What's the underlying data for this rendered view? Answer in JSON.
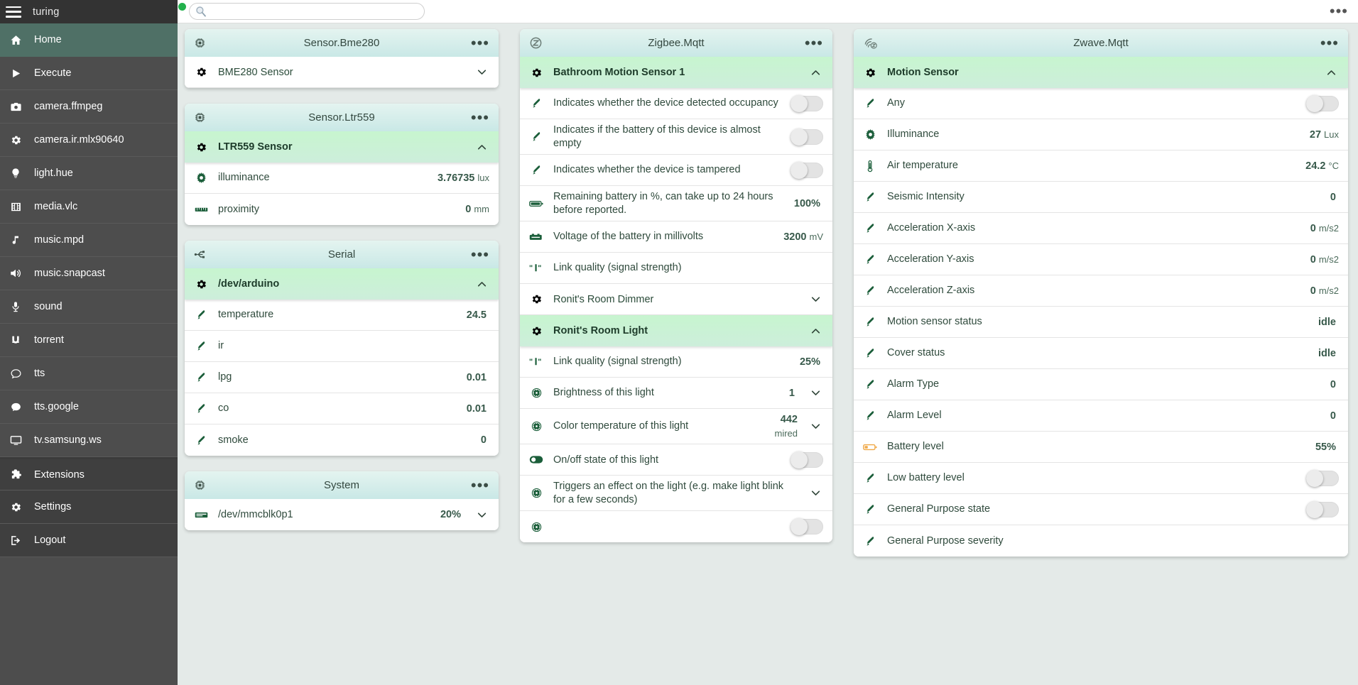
{
  "sidebar": {
    "brand": "turing",
    "items": [
      {
        "label": "Home",
        "icon": "home-icon",
        "active": true
      },
      {
        "label": "Execute",
        "icon": "play-icon"
      },
      {
        "label": "camera.ffmpeg",
        "icon": "camera-icon"
      },
      {
        "label": "camera.ir.mlx90640",
        "icon": "gear-icon"
      },
      {
        "label": "light.hue",
        "icon": "bulb-icon"
      },
      {
        "label": "media.vlc",
        "icon": "film-icon"
      },
      {
        "label": "music.mpd",
        "icon": "music-note-icon"
      },
      {
        "label": "music.snapcast",
        "icon": "speaker-icon"
      },
      {
        "label": "sound",
        "icon": "microphone-icon"
      },
      {
        "label": "torrent",
        "icon": "magnet-icon"
      },
      {
        "label": "tts",
        "icon": "chat-outline-icon"
      },
      {
        "label": "tts.google",
        "icon": "chat-filled-icon"
      },
      {
        "label": "tv.samsung.ws",
        "icon": "monitor-icon"
      }
    ],
    "footer_items": [
      {
        "label": "Extensions",
        "icon": "puzzle-icon"
      },
      {
        "label": "Settings",
        "icon": "gear-icon"
      },
      {
        "label": "Logout",
        "icon": "logout-icon"
      }
    ]
  },
  "topbar": {
    "search_placeholder": "",
    "search_value": "",
    "status_color": "#22b14c",
    "menu_label": "•••"
  },
  "columns": [
    {
      "cards": [
        {
          "title": "Sensor.Bme280",
          "icon": "chip-icon",
          "menu": "•••",
          "groups": [
            {
              "label": "BME280 Sensor",
              "icon": "gear-icon",
              "expanded": false,
              "chevron": "down",
              "rows": []
            }
          ]
        },
        {
          "title": "Sensor.Ltr559",
          "icon": "chip-icon",
          "menu": "•••",
          "groups": [
            {
              "label": "LTR559 Sensor",
              "icon": "gear-icon",
              "expanded": true,
              "chevron": "up",
              "rows": [
                {
                  "label": "illuminance",
                  "icon": "sun-icon",
                  "value": "3.76735",
                  "unit": "lux"
                },
                {
                  "label": "proximity",
                  "icon": "ruler-icon",
                  "value": "0",
                  "unit": "mm"
                }
              ]
            }
          ]
        },
        {
          "title": "Serial",
          "icon": "usb-icon",
          "menu": "•••",
          "groups": [
            {
              "label": "/dev/arduino",
              "icon": "gear-icon",
              "expanded": true,
              "chevron": "up",
              "rows": [
                {
                  "label": "temperature",
                  "icon": "thermometer-icon",
                  "value": "24.5",
                  "unit": ""
                },
                {
                  "label": "ir",
                  "icon": "thermometer-icon",
                  "value": "",
                  "unit": ""
                },
                {
                  "label": "lpg",
                  "icon": "thermometer-icon",
                  "value": "0.01",
                  "unit": ""
                },
                {
                  "label": "co",
                  "icon": "thermometer-icon",
                  "value": "0.01",
                  "unit": ""
                },
                {
                  "label": "smoke",
                  "icon": "thermometer-icon",
                  "value": "0",
                  "unit": ""
                }
              ]
            }
          ]
        },
        {
          "title": "System",
          "icon": "chip-icon",
          "menu": "•••",
          "groups": [
            {
              "label": "",
              "icon": "",
              "expanded": true,
              "chevron": "",
              "rows": [
                {
                  "label": "/dev/mmcblk0p1",
                  "icon": "disk-icon",
                  "value": "20%",
                  "unit": "",
                  "chevron": "down"
                }
              ]
            }
          ]
        }
      ]
    },
    {
      "cards": [
        {
          "title": "Zigbee.Mqtt",
          "icon": "zigbee-icon",
          "menu": "•••",
          "groups": [
            {
              "label": "Bathroom Motion Sensor 1",
              "icon": "gear-icon",
              "expanded": true,
              "chevron": "up",
              "rows": [
                {
                  "label": "Indicates whether the device detected occupancy",
                  "icon": "thermometer-icon",
                  "toggle": "off"
                },
                {
                  "label": "Indicates if the battery of this device is almost empty",
                  "icon": "thermometer-icon",
                  "toggle": "off"
                },
                {
                  "label": "Indicates whether the device is tampered",
                  "icon": "thermometer-icon",
                  "toggle": "off"
                },
                {
                  "label": "Remaining battery in %, can take up to 24 hours before reported.",
                  "icon": "battery-icon",
                  "value": "100%",
                  "unit": ""
                },
                {
                  "label": "Voltage of the battery in millivolts",
                  "icon": "battery-volt-icon",
                  "value": "3200",
                  "unit": "mV"
                },
                {
                  "label": "Link quality (signal strength)",
                  "icon": "signal-icon",
                  "value": "",
                  "unit": ""
                }
              ]
            },
            {
              "label": "Ronit's Room Dimmer",
              "icon": "gear-icon",
              "expanded": false,
              "chevron": "down",
              "rows": []
            },
            {
              "label": "Ronit's Room Light",
              "icon": "gear-icon",
              "expanded": true,
              "chevron": "up",
              "rows": [
                {
                  "label": "Link quality (signal strength)",
                  "icon": "signal-icon",
                  "value": "25%",
                  "unit": ""
                },
                {
                  "label": "Brightness of this light",
                  "icon": "dial-icon",
                  "value": "1",
                  "unit": "",
                  "chevron": "down"
                },
                {
                  "label": "Color temperature of this light",
                  "icon": "dial-icon",
                  "value": "442",
                  "unit": "mired",
                  "chevron": "down",
                  "wrap": true
                },
                {
                  "label": "On/off state of this light",
                  "icon": "switch-icon",
                  "toggle": "off"
                },
                {
                  "label": "Triggers an effect on the light (e.g. make light blink for a few seconds)",
                  "icon": "dial-icon",
                  "value": "",
                  "unit": "",
                  "chevron": "down"
                },
                {
                  "label": "",
                  "icon": "dial-icon",
                  "toggle": "off"
                }
              ]
            }
          ]
        }
      ]
    },
    {
      "cards": [
        {
          "title": "Zwave.Mqtt",
          "icon": "zwave-icon",
          "menu": "•••",
          "groups": [
            {
              "label": "Motion Sensor",
              "icon": "gear-icon",
              "expanded": true,
              "chevron": "up",
              "rows": [
                {
                  "label": "Any",
                  "icon": "thermometer-icon",
                  "toggle": "off"
                },
                {
                  "label": "Illuminance",
                  "icon": "sun-icon",
                  "value": "27",
                  "unit": "Lux"
                },
                {
                  "label": "Air temperature",
                  "icon": "thermometer-vert-icon",
                  "value": "24.2",
                  "unit": "°C"
                },
                {
                  "label": "Seismic Intensity",
                  "icon": "thermometer-icon",
                  "value": "0",
                  "unit": ""
                },
                {
                  "label": "Acceleration X-axis",
                  "icon": "thermometer-icon",
                  "value": "0",
                  "unit": "m/s2"
                },
                {
                  "label": "Acceleration Y-axis",
                  "icon": "thermometer-icon",
                  "value": "0",
                  "unit": "m/s2"
                },
                {
                  "label": "Acceleration Z-axis",
                  "icon": "thermometer-icon",
                  "value": "0",
                  "unit": "m/s2"
                },
                {
                  "label": "Motion sensor status",
                  "icon": "thermometer-icon",
                  "value": "idle",
                  "unit": ""
                },
                {
                  "label": "Cover status",
                  "icon": "thermometer-icon",
                  "value": "idle",
                  "unit": ""
                },
                {
                  "label": "Alarm Type",
                  "icon": "thermometer-icon",
                  "value": "0",
                  "unit": ""
                },
                {
                  "label": "Alarm Level",
                  "icon": "thermometer-icon",
                  "value": "0",
                  "unit": ""
                },
                {
                  "label": "Battery level",
                  "icon": "battery-low-icon",
                  "value": "55%",
                  "unit": ""
                },
                {
                  "label": "Low battery level",
                  "icon": "thermometer-icon",
                  "toggle": "off"
                },
                {
                  "label": "General Purpose state",
                  "icon": "thermometer-icon",
                  "toggle": "off"
                },
                {
                  "label": "General Purpose severity",
                  "icon": "thermometer-icon",
                  "value": "",
                  "unit": ""
                }
              ]
            }
          ]
        }
      ]
    }
  ]
}
